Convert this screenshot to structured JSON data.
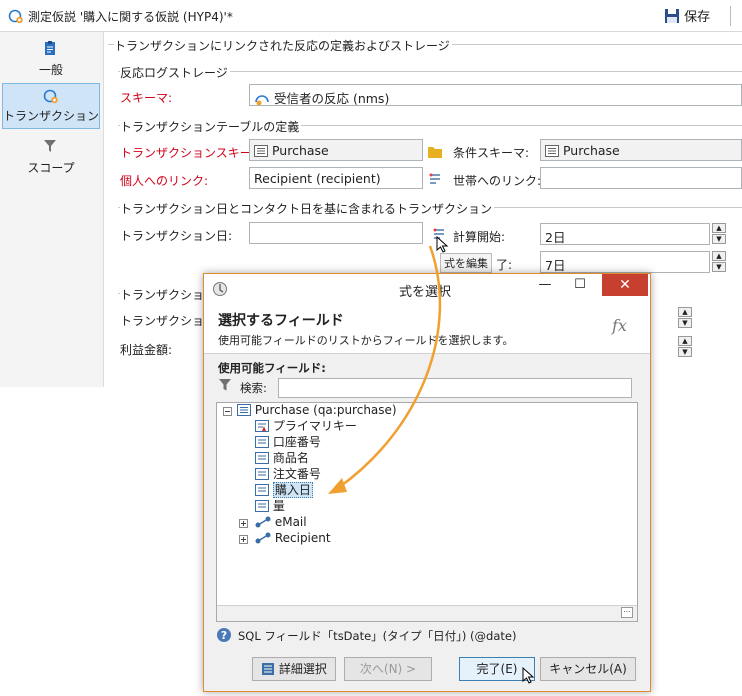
{
  "window": {
    "title": "測定仮説 '購入に関する仮説 (HYP4)'*",
    "save_label": "保存"
  },
  "sidebar": {
    "items": [
      {
        "label": "一般",
        "icon": "clipboard-icon"
      },
      {
        "label": "トランザクション",
        "icon": "transaction-icon"
      },
      {
        "label": "スコープ",
        "icon": "filter-funnel-icon"
      }
    ]
  },
  "form": {
    "main_section": "トランザクションにリンクされた反応の定義およびストレージ",
    "reaction_log": {
      "section": "反応ログストレージ",
      "schema_label": "スキーマ:",
      "schema_value": "受信者の反応 (nms)"
    },
    "transaction_table": {
      "section": "トランザクションテーブルの定義",
      "tx_schema_label": "トランザクションスキーマ:",
      "tx_schema_value": "Purchase",
      "cond_schema_label": "条件スキーマ:",
      "cond_schema_value": "Purchase",
      "individual_link_label": "個人へのリンク:",
      "individual_link_value": "Recipient (recipient)",
      "household_link_label": "世帯へのリンク:",
      "household_link_value": ""
    },
    "tx_dates": {
      "section": "トランザクション日とコンタクト日を基に含まれるトランザクション",
      "tx_date_label": "トランザクション日:",
      "tx_date_value": "",
      "calc_start_label": "計算開始:",
      "calc_start_value": "2日",
      "edit_expr_label": "式を編集",
      "calc_end_label_visible": "了:",
      "calc_end_value": "7日"
    },
    "tx_amount_section_visible": "トランザクションの",
    "tx_amount_label_visible": "トランザクション金",
    "profit_label": "利益金額:"
  },
  "dialog": {
    "title": "式を選択",
    "header_title": "選択するフィールド",
    "header_subtitle": "使用可能フィールドのリストからフィールドを選択します。",
    "fx_label": "fx",
    "available_fields_label": "使用可能フィールド:",
    "search_label": "検索:",
    "search_value": "",
    "tree": {
      "root": "Purchase (qa:purchase)",
      "fields": [
        "プライマリキー",
        "口座番号",
        "商品名",
        "注文番号",
        "購入日",
        "量"
      ],
      "selected_index": 4,
      "links": [
        "eMail",
        "Recipient"
      ]
    },
    "status_text": "SQL フィールド「tsDate」(タイプ「日付」) (@date)",
    "buttons": {
      "advanced": "詳細選択",
      "next": "次へ(N) >",
      "finish": "完了(E)",
      "cancel": "キャンセル(A)"
    }
  },
  "colors": {
    "accent_orange": "#f0a030",
    "selection_blue": "#cfe5f7",
    "required_red": "#d0021b",
    "close_red": "#c7402f"
  }
}
